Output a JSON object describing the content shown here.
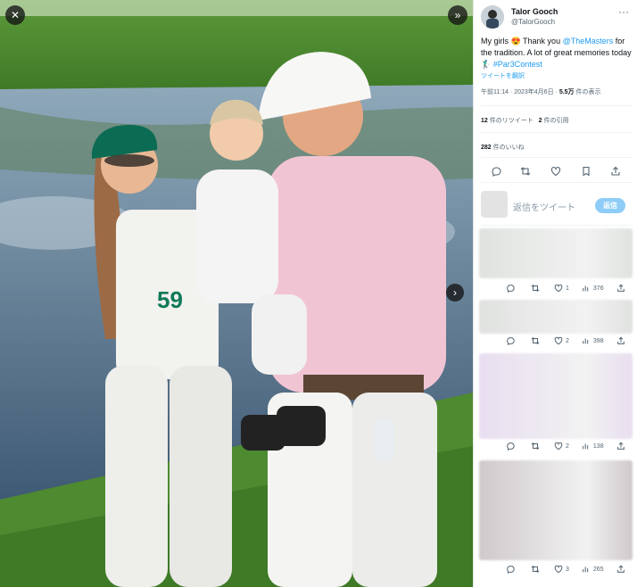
{
  "viewer": {
    "close_glyph": "✕",
    "next_glyph": "»",
    "advance_glyph": "›",
    "caddie_number": "59",
    "colors": {
      "grass": "#4a8a2e",
      "water": "#4d6b86",
      "shirt_pink": "#f1c4d4",
      "white": "#f7f7f5",
      "hat_green": "#0c6b53"
    }
  },
  "tweet": {
    "author_name": "Talor Gooch",
    "author_handle": "@TalorGooch",
    "text_part1": "My girls 😍 Thank you ",
    "mention": "@TheMasters",
    "text_part2": " for the tradition. A lot of great memories today 🏌️‍♂️ ",
    "hashtag": "#Par3Contest",
    "translate": "ツイートを翻訳",
    "time": "午前11:14 · 2023年4月6日 · ",
    "views_count": "5.5万",
    "views_label": " 件の表示",
    "retweets_count": "12",
    "retweets_label": " 件のリツイート",
    "quotes_count": "2",
    "quotes_label": " 件の引用",
    "likes_count": "282",
    "likes_label": " 件のいいね",
    "reply_placeholder": "返信をツイート",
    "reply_button": "返信"
  },
  "replies": [
    {
      "likes": "1",
      "views": "376",
      "blur_color": "#dfe3df"
    },
    {
      "likes": "2",
      "views": "398",
      "blur_color": "#e0e2e0"
    },
    {
      "likes": "2",
      "views": "138",
      "blur_color": "#e8def0"
    },
    {
      "likes": "3",
      "views": "265",
      "blur_color": "#cfc9cb"
    }
  ],
  "icons": [
    "close-icon",
    "next-icon",
    "arrow-right-icon",
    "verified-avatar-icon",
    "more-icon",
    "reply-icon",
    "retweet-icon",
    "like-icon",
    "bookmark-icon",
    "share-icon"
  ]
}
